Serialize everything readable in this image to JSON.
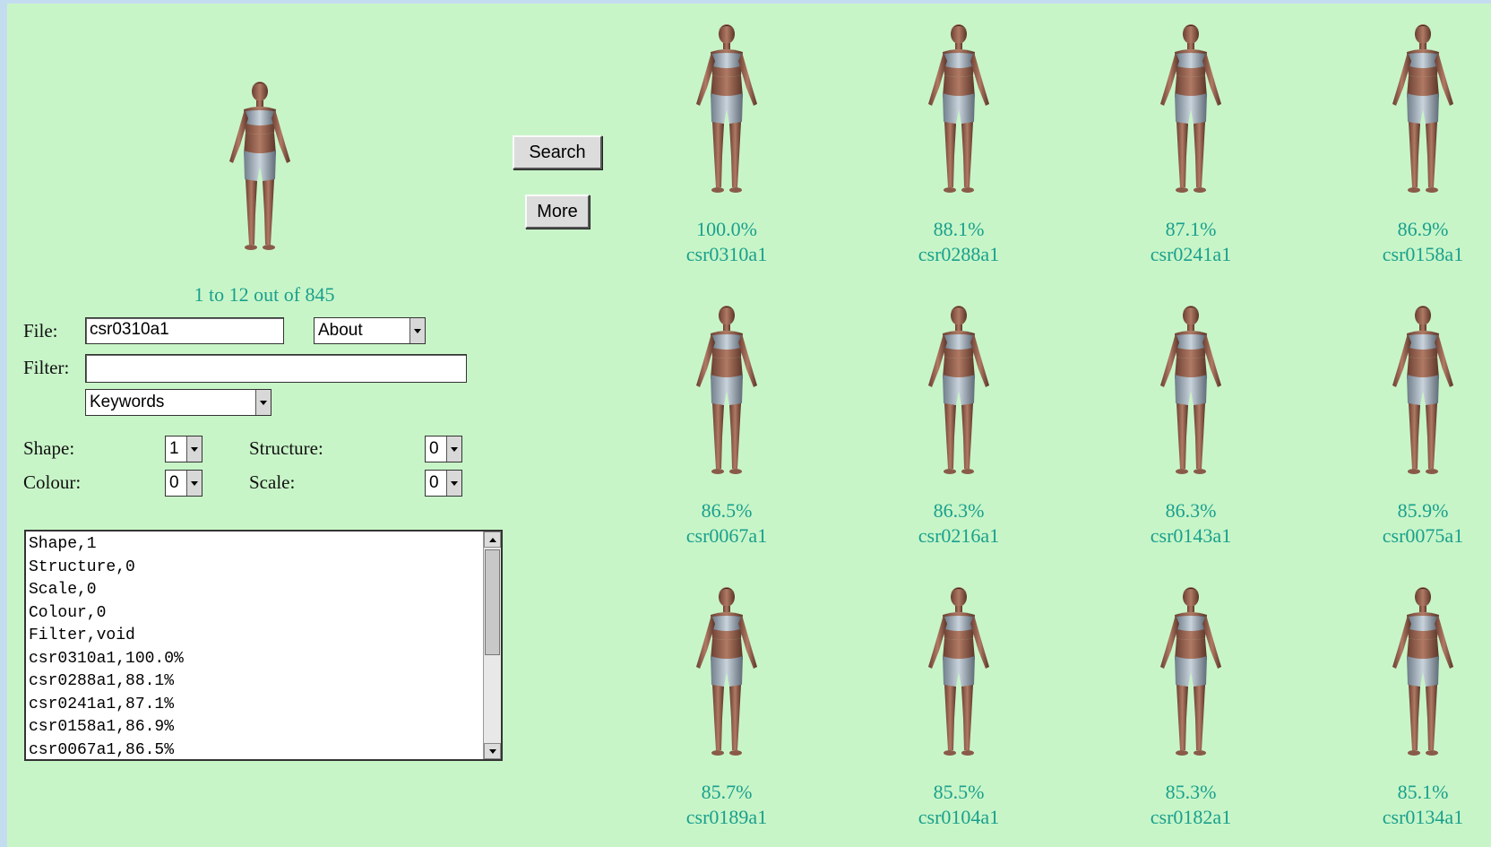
{
  "query": {
    "result_count": "1 to 12 out of 845"
  },
  "form": {
    "file_label": "File:",
    "file_value": "csr0310a1",
    "about_select": "About",
    "filter_label": "Filter:",
    "filter_value": "",
    "keywords_select": "Keywords",
    "shape_label": "Shape:",
    "shape_value": "1",
    "structure_label": "Structure:",
    "structure_value": "0",
    "colour_label": "Colour:",
    "colour_value": "0",
    "scale_label": "Scale:",
    "scale_value": "0"
  },
  "buttons": {
    "search": "Search",
    "more": "More"
  },
  "log": {
    "lines": [
      "Shape,1",
      "Structure,0",
      "Scale,0",
      "Colour,0",
      "Filter,void",
      "csr0310a1,100.0%",
      "csr0288a1,88.1%",
      "csr0241a1,87.1%",
      "csr0158a1,86.9%",
      "csr0067a1,86.5%"
    ]
  },
  "results": [
    {
      "pct": "100.0%",
      "name": "csr0310a1"
    },
    {
      "pct": "88.1%",
      "name": "csr0288a1"
    },
    {
      "pct": "87.1%",
      "name": "csr0241a1"
    },
    {
      "pct": "86.9%",
      "name": "csr0158a1"
    },
    {
      "pct": "86.5%",
      "name": "csr0067a1"
    },
    {
      "pct": "86.3%",
      "name": "csr0216a1"
    },
    {
      "pct": "86.3%",
      "name": "csr0143a1"
    },
    {
      "pct": "85.9%",
      "name": "csr0075a1"
    },
    {
      "pct": "85.7%",
      "name": "csr0189a1"
    },
    {
      "pct": "85.5%",
      "name": "csr0104a1"
    },
    {
      "pct": "85.3%",
      "name": "csr0182a1"
    },
    {
      "pct": "85.1%",
      "name": "csr0134a1"
    }
  ],
  "colors": {
    "background": "#c8f5c8",
    "accent_text": "#19a08c"
  }
}
